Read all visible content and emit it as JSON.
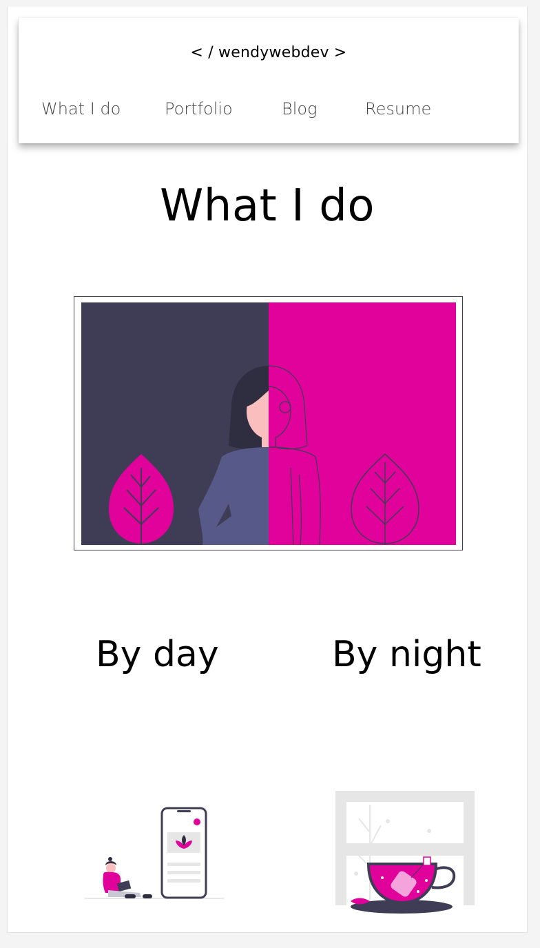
{
  "header": {
    "brand": "< / wendywebdev >",
    "nav": [
      {
        "label": "What I do"
      },
      {
        "label": "Portfolio"
      },
      {
        "label": "Blog"
      },
      {
        "label": "Resume"
      }
    ]
  },
  "main": {
    "title": "What I do",
    "hero_image": "split-portrait-illustration",
    "columns": [
      {
        "title": "By day",
        "image": "phone-app-illustration"
      },
      {
        "title": "By night",
        "image": "tea-cup-illustration"
      }
    ]
  },
  "colors": {
    "accent": "#e0029a",
    "dark": "#3f3d56",
    "shirt": "#575a89",
    "hair": "#2f2e41",
    "skin": "#fbbebe"
  }
}
